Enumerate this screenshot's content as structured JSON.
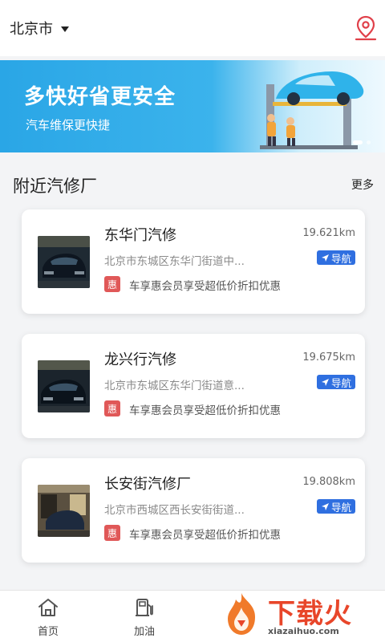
{
  "header": {
    "city": "北京市"
  },
  "banner": {
    "title": "多快好省更安全",
    "subtitle": "汽车维保更快捷",
    "slide_count": 2,
    "active_slide": 1
  },
  "section": {
    "title": "附近汽修厂",
    "more_label": "更多"
  },
  "shops": [
    {
      "name": "东华门汽修",
      "distance": "19.621km",
      "address": "北京市东城区东华门街道中...",
      "nav_label": "导航",
      "badge": "惠",
      "promo": "车享惠会员享受超低价折扣优惠"
    },
    {
      "name": "龙兴行汽修",
      "distance": "19.675km",
      "address": "北京市东城区东华门街道意...",
      "nav_label": "导航",
      "badge": "惠",
      "promo": "车享惠会员享受超低价折扣优惠"
    },
    {
      "name": "长安街汽修厂",
      "distance": "19.808km",
      "address": "北京市西城区西长安街街道...",
      "nav_label": "导航",
      "badge": "惠",
      "promo": "车享惠会员享受超低价折扣优惠"
    }
  ],
  "tabs": [
    {
      "label": "首页",
      "icon": "home-icon"
    },
    {
      "label": "加油",
      "icon": "fuel-pump-icon"
    }
  ],
  "watermark": {
    "text": "下载火",
    "url": "xiazaihuo.com"
  },
  "colors": {
    "accent": "#2f6fe0",
    "badge": "#e05858",
    "banner": "#2aa6e6",
    "location_icon": "#e0404a"
  }
}
